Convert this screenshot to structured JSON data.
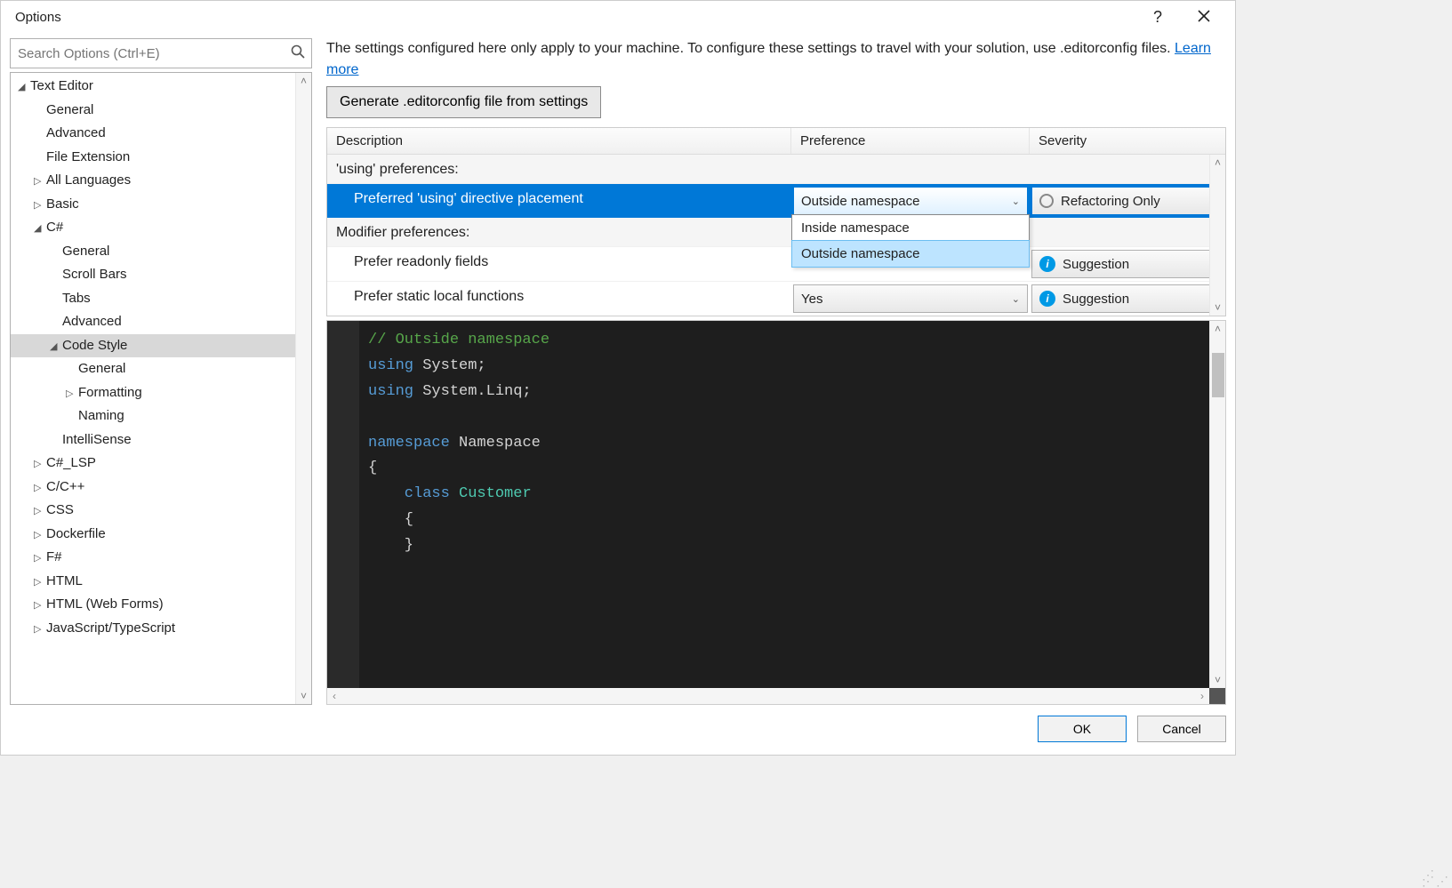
{
  "window": {
    "title": "Options"
  },
  "search": {
    "placeholder": "Search Options (Ctrl+E)"
  },
  "tree": {
    "items": [
      {
        "label": "Text Editor",
        "depth": 0,
        "caret": "down"
      },
      {
        "label": "General",
        "depth": 1
      },
      {
        "label": "Advanced",
        "depth": 1
      },
      {
        "label": "File Extension",
        "depth": 1
      },
      {
        "label": "All Languages",
        "depth": 1,
        "caret": "right"
      },
      {
        "label": "Basic",
        "depth": 1,
        "caret": "right"
      },
      {
        "label": "C#",
        "depth": 1,
        "caret": "down"
      },
      {
        "label": "General",
        "depth": 2
      },
      {
        "label": "Scroll Bars",
        "depth": 2
      },
      {
        "label": "Tabs",
        "depth": 2
      },
      {
        "label": "Advanced",
        "depth": 2
      },
      {
        "label": "Code Style",
        "depth": 2,
        "caret": "down",
        "selected": true
      },
      {
        "label": "General",
        "depth": 3
      },
      {
        "label": "Formatting",
        "depth": 3,
        "caret": "right"
      },
      {
        "label": "Naming",
        "depth": 3
      },
      {
        "label": "IntelliSense",
        "depth": 2
      },
      {
        "label": "C#_LSP",
        "depth": 1,
        "caret": "right"
      },
      {
        "label": "C/C++",
        "depth": 1,
        "caret": "right"
      },
      {
        "label": "CSS",
        "depth": 1,
        "caret": "right"
      },
      {
        "label": "Dockerfile",
        "depth": 1,
        "caret": "right"
      },
      {
        "label": "F#",
        "depth": 1,
        "caret": "right"
      },
      {
        "label": "HTML",
        "depth": 1,
        "caret": "right"
      },
      {
        "label": "HTML (Web Forms)",
        "depth": 1,
        "caret": "right"
      },
      {
        "label": "JavaScript/TypeScript",
        "depth": 1,
        "caret": "right"
      }
    ]
  },
  "info": {
    "text_a": "The settings configured here only apply to your machine. To configure these settings to travel with your solution, use .editorconfig files.  ",
    "link": "Learn more"
  },
  "generate_button": "Generate .editorconfig file from settings",
  "grid": {
    "headers": {
      "desc": "Description",
      "pref": "Preference",
      "sev": "Severity"
    },
    "group1": "'using' preferences:",
    "row1": {
      "desc": "Preferred 'using' directive placement",
      "pref": "Outside namespace",
      "sev": "Refactoring Only",
      "dropdown": {
        "opt1": "Inside namespace",
        "opt2": "Outside namespace"
      }
    },
    "group2": "Modifier preferences:",
    "row2": {
      "desc": "Prefer readonly fields",
      "sev": "Suggestion"
    },
    "row3": {
      "desc": "Prefer static local functions",
      "pref": "Yes",
      "sev": "Suggestion"
    }
  },
  "code": {
    "l1": "// Outside namespace",
    "l2a": "using",
    "l2b": " System;",
    "l3a": "using",
    "l3b": " System.Linq;",
    "l4": "",
    "l5a": "namespace",
    "l5b": " Namespace",
    "l6": "{",
    "l7a": "    class ",
    "l7b": "Customer",
    "l8": "    {",
    "l9": "    }"
  },
  "buttons": {
    "ok": "OK",
    "cancel": "Cancel"
  }
}
